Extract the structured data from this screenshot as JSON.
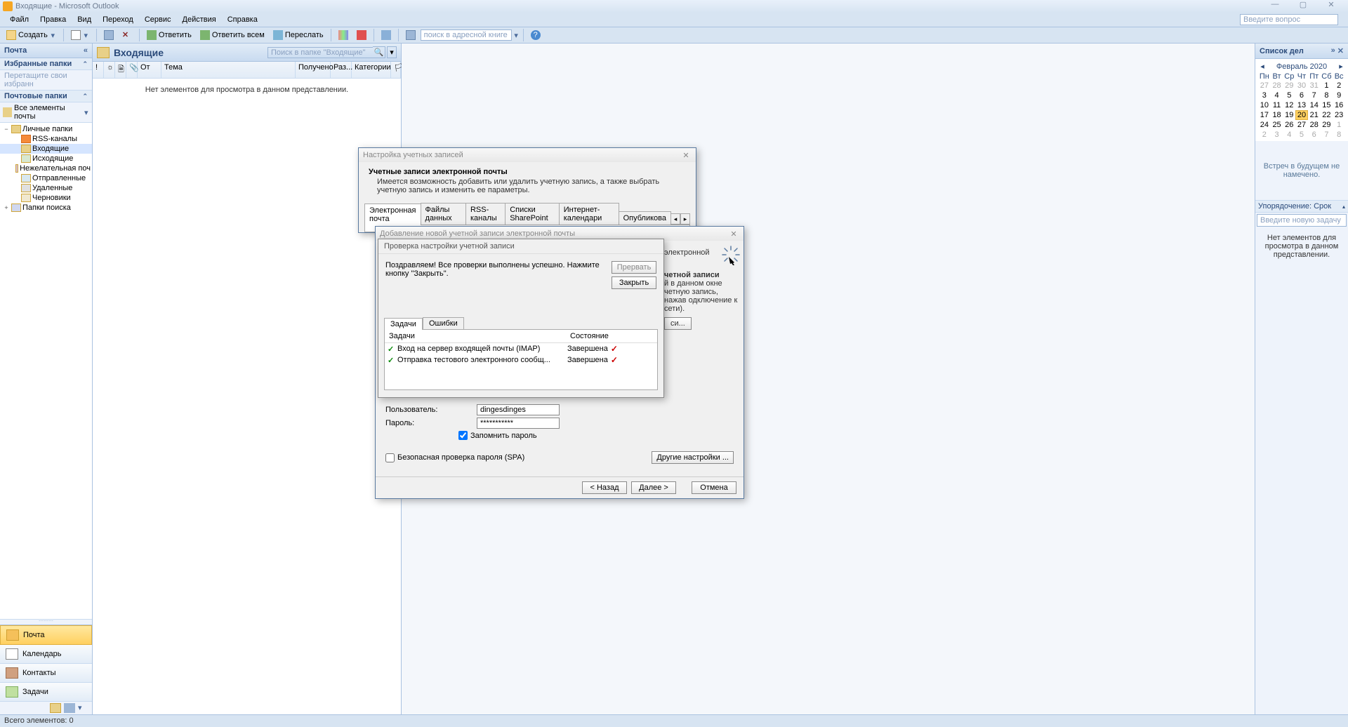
{
  "title": "Входящие - Microsoft Outlook",
  "menu": [
    "Файл",
    "Правка",
    "Вид",
    "Переход",
    "Сервис",
    "Действия",
    "Справка"
  ],
  "ask": "Введите вопрос",
  "toolbar": {
    "new": "Создать",
    "reply": "Ответить",
    "reply_all": "Ответить всем",
    "forward": "Переслать",
    "addr_search": "поиск в адресной книге"
  },
  "nav": {
    "title": "Почта",
    "fav": "Избранные папки",
    "fav_hint": "Перетащите свои избранн",
    "mailfolders": "Почтовые папки",
    "allitems": "Все элементы почты",
    "tree": [
      {
        "label": "Личные папки",
        "icon": "in",
        "lvl": 0,
        "exp": "−"
      },
      {
        "label": "RSS-каналы",
        "icon": "rss",
        "lvl": 1
      },
      {
        "label": "Входящие",
        "icon": "in",
        "lvl": 1,
        "sel": true
      },
      {
        "label": "Исходящие",
        "icon": "out",
        "lvl": 1
      },
      {
        "label": "Нежелательная поч",
        "icon": "junk",
        "lvl": 1
      },
      {
        "label": "Отправленные",
        "icon": "sent",
        "lvl": 1
      },
      {
        "label": "Удаленные",
        "icon": "del",
        "lvl": 1
      },
      {
        "label": "Черновики",
        "icon": "draft",
        "lvl": 1
      },
      {
        "label": "Папки поиска",
        "icon": "search",
        "lvl": 0,
        "exp": "+"
      }
    ],
    "big": [
      {
        "label": "Почта",
        "icon": "mail",
        "act": true
      },
      {
        "label": "Календарь",
        "icon": "cal"
      },
      {
        "label": "Контакты",
        "icon": "cont"
      },
      {
        "label": "Задачи",
        "icon": "task"
      }
    ]
  },
  "msg": {
    "title": "Входящие",
    "search_ph": "Поиск в папке \"Входящие\"",
    "cols": {
      "from": "От",
      "subj": "Тема",
      "recv": "Получено",
      "size": "Раз...",
      "cat": "Категории"
    },
    "empty": "Нет элементов для просмотра в данном представлении."
  },
  "todo": {
    "title": "Список дел",
    "month": "Февраль 2020",
    "dh": [
      "Пн",
      "Вт",
      "Ср",
      "Чт",
      "Пт",
      "Сб",
      "Вс"
    ],
    "days_pre": [
      27,
      28,
      29,
      30,
      31
    ],
    "days": [
      1,
      2,
      3,
      4,
      5,
      6,
      7,
      8,
      9,
      10,
      11,
      12,
      13,
      14,
      15,
      16,
      17,
      18,
      19,
      20,
      21,
      22,
      23,
      24,
      25,
      26,
      27,
      28,
      29
    ],
    "days_post": [
      1,
      2,
      3,
      4,
      5,
      6,
      7,
      8
    ],
    "today": 20,
    "nomeet": "Встреч в будущем не намечено.",
    "arrange": "Упорядочение: Срок",
    "newtask": "Введите новую задачу",
    "noitems": "Нет элементов для просмотра в данном представлении."
  },
  "status": "Всего элементов: 0",
  "dlg1": {
    "title": "Настройка учетных записей",
    "h": "Учетные записи электронной почты",
    "sub": "Имеется возможность добавить или удалить учетную запись, а также выбрать учетную запись и изменить ее параметры.",
    "tabs": [
      "Электронная почта",
      "Файлы данных",
      "RSS-каналы",
      "Списки SharePoint",
      "Интернет-календари",
      "Опубликова"
    ]
  },
  "dlg2": {
    "title": "Добавление новой учетной записи электронной почты",
    "right1": "электронной",
    "right2b": "четной записи",
    "right2": "й в данном окне четную запись, нажав одключение к сети).",
    "right_btn": "си...",
    "user_l": "Пользователь:",
    "user_v": "dingesdinges",
    "pass_l": "Пароль:",
    "pass_v": "***********",
    "remember": "Запомнить пароль",
    "spa": "Безопасная проверка пароля (SPA)",
    "other": "Другие настройки ...",
    "back": "< Назад",
    "next": "Далее >",
    "cancel": "Отмена"
  },
  "dlg3": {
    "title": "Проверка настройки учетной записи",
    "msg": "Поздравляем! Все проверки выполнены успешно. Нажмите кнопку \"Закрыть\".",
    "stop": "Прервать",
    "close": "Закрыть",
    "tab_tasks": "Задачи",
    "tab_err": "Ошибки",
    "th_task": "Задачи",
    "th_state": "Состояние",
    "t1": "Вход на сервер входящей почты (IMAP)",
    "t2": "Отправка тестового электронного сообщ...",
    "done": "Завершена"
  }
}
